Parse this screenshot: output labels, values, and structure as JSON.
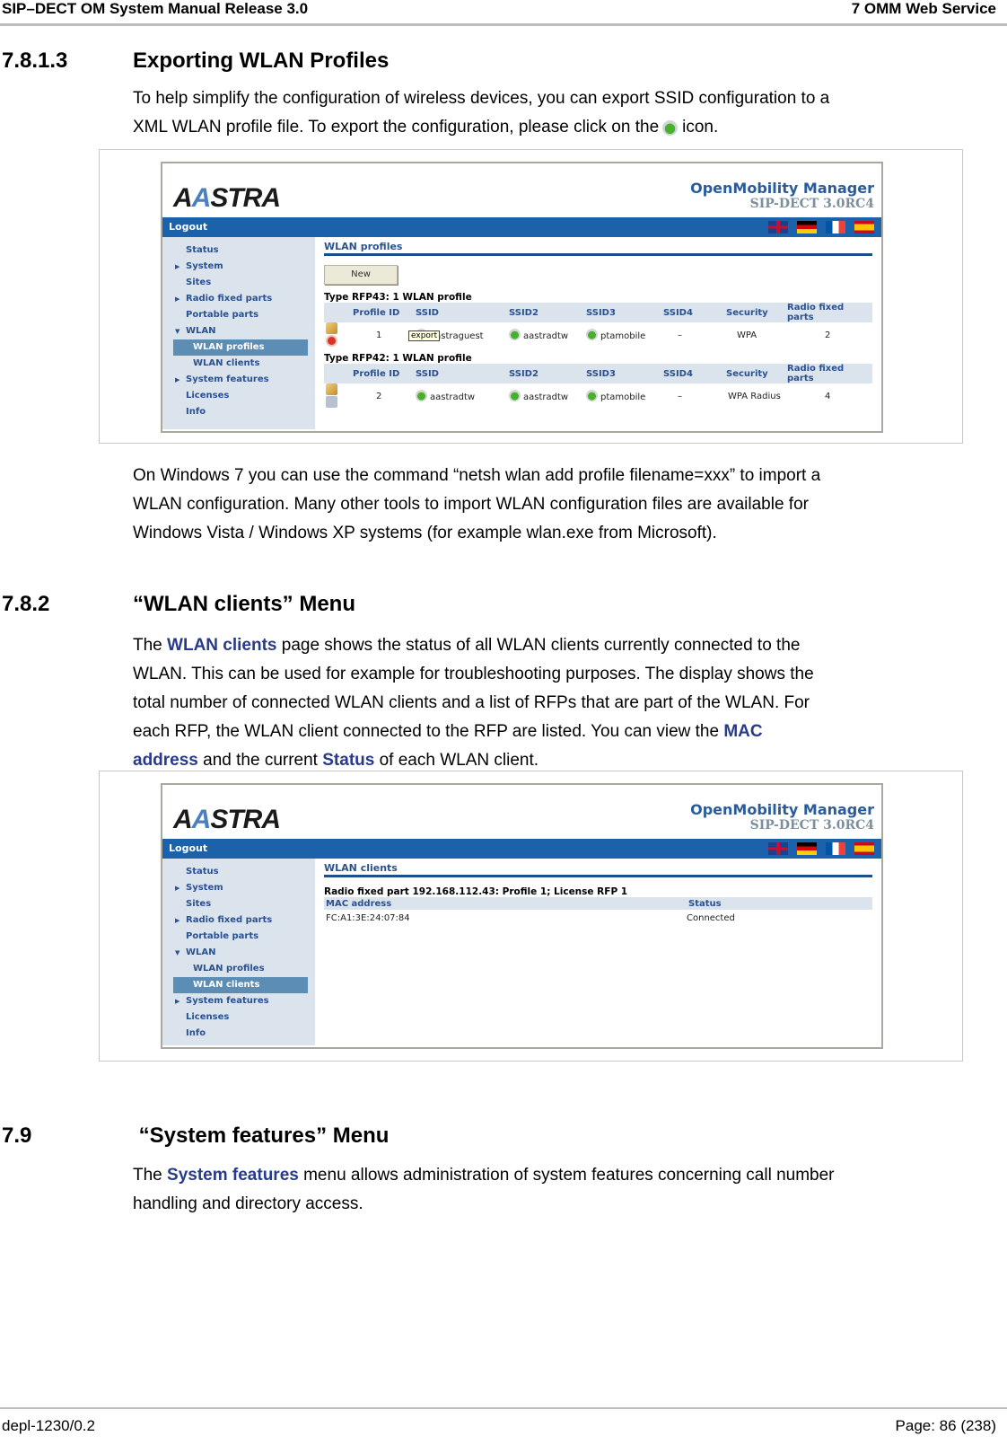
{
  "header": {
    "left": "SIP–DECT OM System Manual Release 3.0",
    "right": "7 OMM Web Service"
  },
  "footer": {
    "left": "depl-1230/0.2",
    "right": "Page: 86 (238)"
  },
  "sec1": {
    "number": "7.8.1.3",
    "title": "Exporting WLAN Profiles",
    "p1_line1": "To help simplify the configuration of wireless devices, you can export SSID configuration to a",
    "p1_line2a": "XML WLAN profile file. To export the configuration, please click on the",
    "p1_line2b": "icon.",
    "p2": [
      "On Windows 7 you can use the command “netsh wlan add profile filename=xxx” to import a",
      "WLAN configuration. Many other tools to import WLAN configuration files are available for",
      "Windows Vista / Windows XP systems (for example wlan.exe from Microsoft)."
    ]
  },
  "sec2": {
    "number": "7.8.2",
    "title": "“WLAN clients” Menu",
    "l1a": "The",
    "l1kw": "WLAN clients",
    "l1b": "page shows the status of all WLAN clients currently connected to the",
    "l2": "WLAN. This can be used for example for troubleshooting purposes. The display shows the",
    "l3": "total number of connected WLAN clients and a list of RFPs that are part of the WLAN. For",
    "l4a": "each RFP, the WLAN client connected to the RFP are listed. You can view the",
    "l4kw": "MAC",
    "l5kw1": "address",
    "l5a": "and the current",
    "l5kw2": "Status",
    "l5b": "of each WLAN client."
  },
  "sec3": {
    "number": "7.9",
    "title": " “System features” Menu",
    "l1a": "The",
    "l1kw": "System features",
    "l1b": "menu allows administration of system features concerning call number",
    "l2": "handling and directory access."
  },
  "app": {
    "logo": "AASTRA",
    "product": "OpenMobility Manager",
    "version": "SIP-DECT 3.0RC4",
    "logout": "Logout",
    "flags": [
      "english",
      "german",
      "french",
      "spanish"
    ],
    "nav": [
      "Status",
      "System",
      "Sites",
      "Radio fixed parts",
      "Portable parts",
      "WLAN",
      "WLAN profiles",
      "WLAN clients",
      "System features",
      "Licenses",
      "Info"
    ]
  },
  "shot1": {
    "title": "WLAN profiles",
    "new_button": "New",
    "tooltip": "export",
    "columns": [
      "",
      "Profile ID",
      "SSID",
      "SSID2",
      "SSID3",
      "SSID4",
      "Security",
      "Radio fixed parts"
    ],
    "groups": [
      {
        "label": "Type RFP43: 1 WLAN profile",
        "row": {
          "id": "1",
          "ssid": "aastraguest",
          "ssid2": "aastradtw",
          "ssid3": "ptamobile",
          "ssid4": "–",
          "security": "WPA",
          "rfps": "2"
        }
      },
      {
        "label": "Type RFP42: 1 WLAN profile",
        "row": {
          "id": "2",
          "ssid": "aastradtw",
          "ssid2": "aastradtw",
          "ssid3": "ptamobile",
          "ssid4": "–",
          "security": "WPA Radius",
          "rfps": "4"
        }
      }
    ]
  },
  "shot2": {
    "title": "WLAN clients",
    "rfp_line": "Radio fixed part 192.168.112.43:  Profile 1;  License RFP 1",
    "columns": [
      "MAC address",
      "Status"
    ],
    "rows": [
      {
        "mac": "FC:A1:3E:24:07:84",
        "status": "Connected"
      }
    ]
  }
}
